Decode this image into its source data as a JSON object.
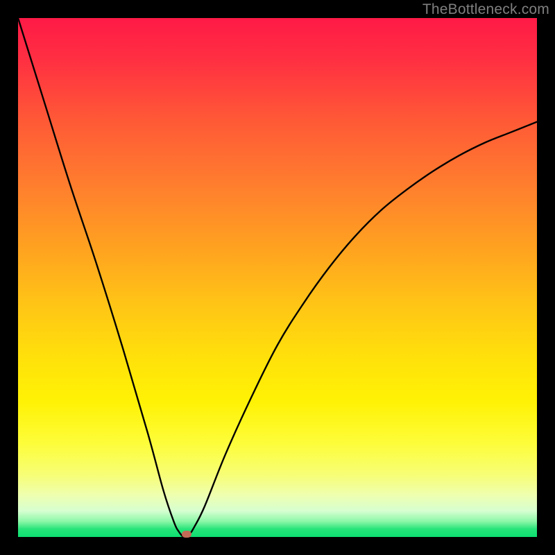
{
  "watermark": "TheBottleneck.com",
  "chart_data": {
    "type": "line",
    "title": "",
    "xlabel": "",
    "ylabel": "",
    "xlim": [
      0,
      100
    ],
    "ylim": [
      0,
      100
    ],
    "grid": false,
    "legend": false,
    "series": [
      {
        "name": "bottleneck-curve",
        "x": [
          0,
          5,
          10,
          15,
          20,
          25,
          28,
          30,
          31,
          32,
          33,
          34,
          36,
          40,
          45,
          50,
          55,
          60,
          65,
          70,
          75,
          80,
          85,
          90,
          95,
          100
        ],
        "values": [
          100,
          84,
          68,
          53,
          37,
          20,
          9,
          3,
          1,
          0,
          0.5,
          2,
          6,
          16,
          27,
          37,
          45,
          52,
          58,
          63,
          67,
          70.5,
          73.5,
          76,
          78,
          80
        ]
      }
    ],
    "marker": {
      "x": 32.5,
      "y": 0.5,
      "shape": "rounded-rect",
      "color": "#c36b56"
    },
    "background_gradient": {
      "top": "#ff1a46",
      "mid": "#ffe20a",
      "bottom": "#0ddf71"
    }
  }
}
